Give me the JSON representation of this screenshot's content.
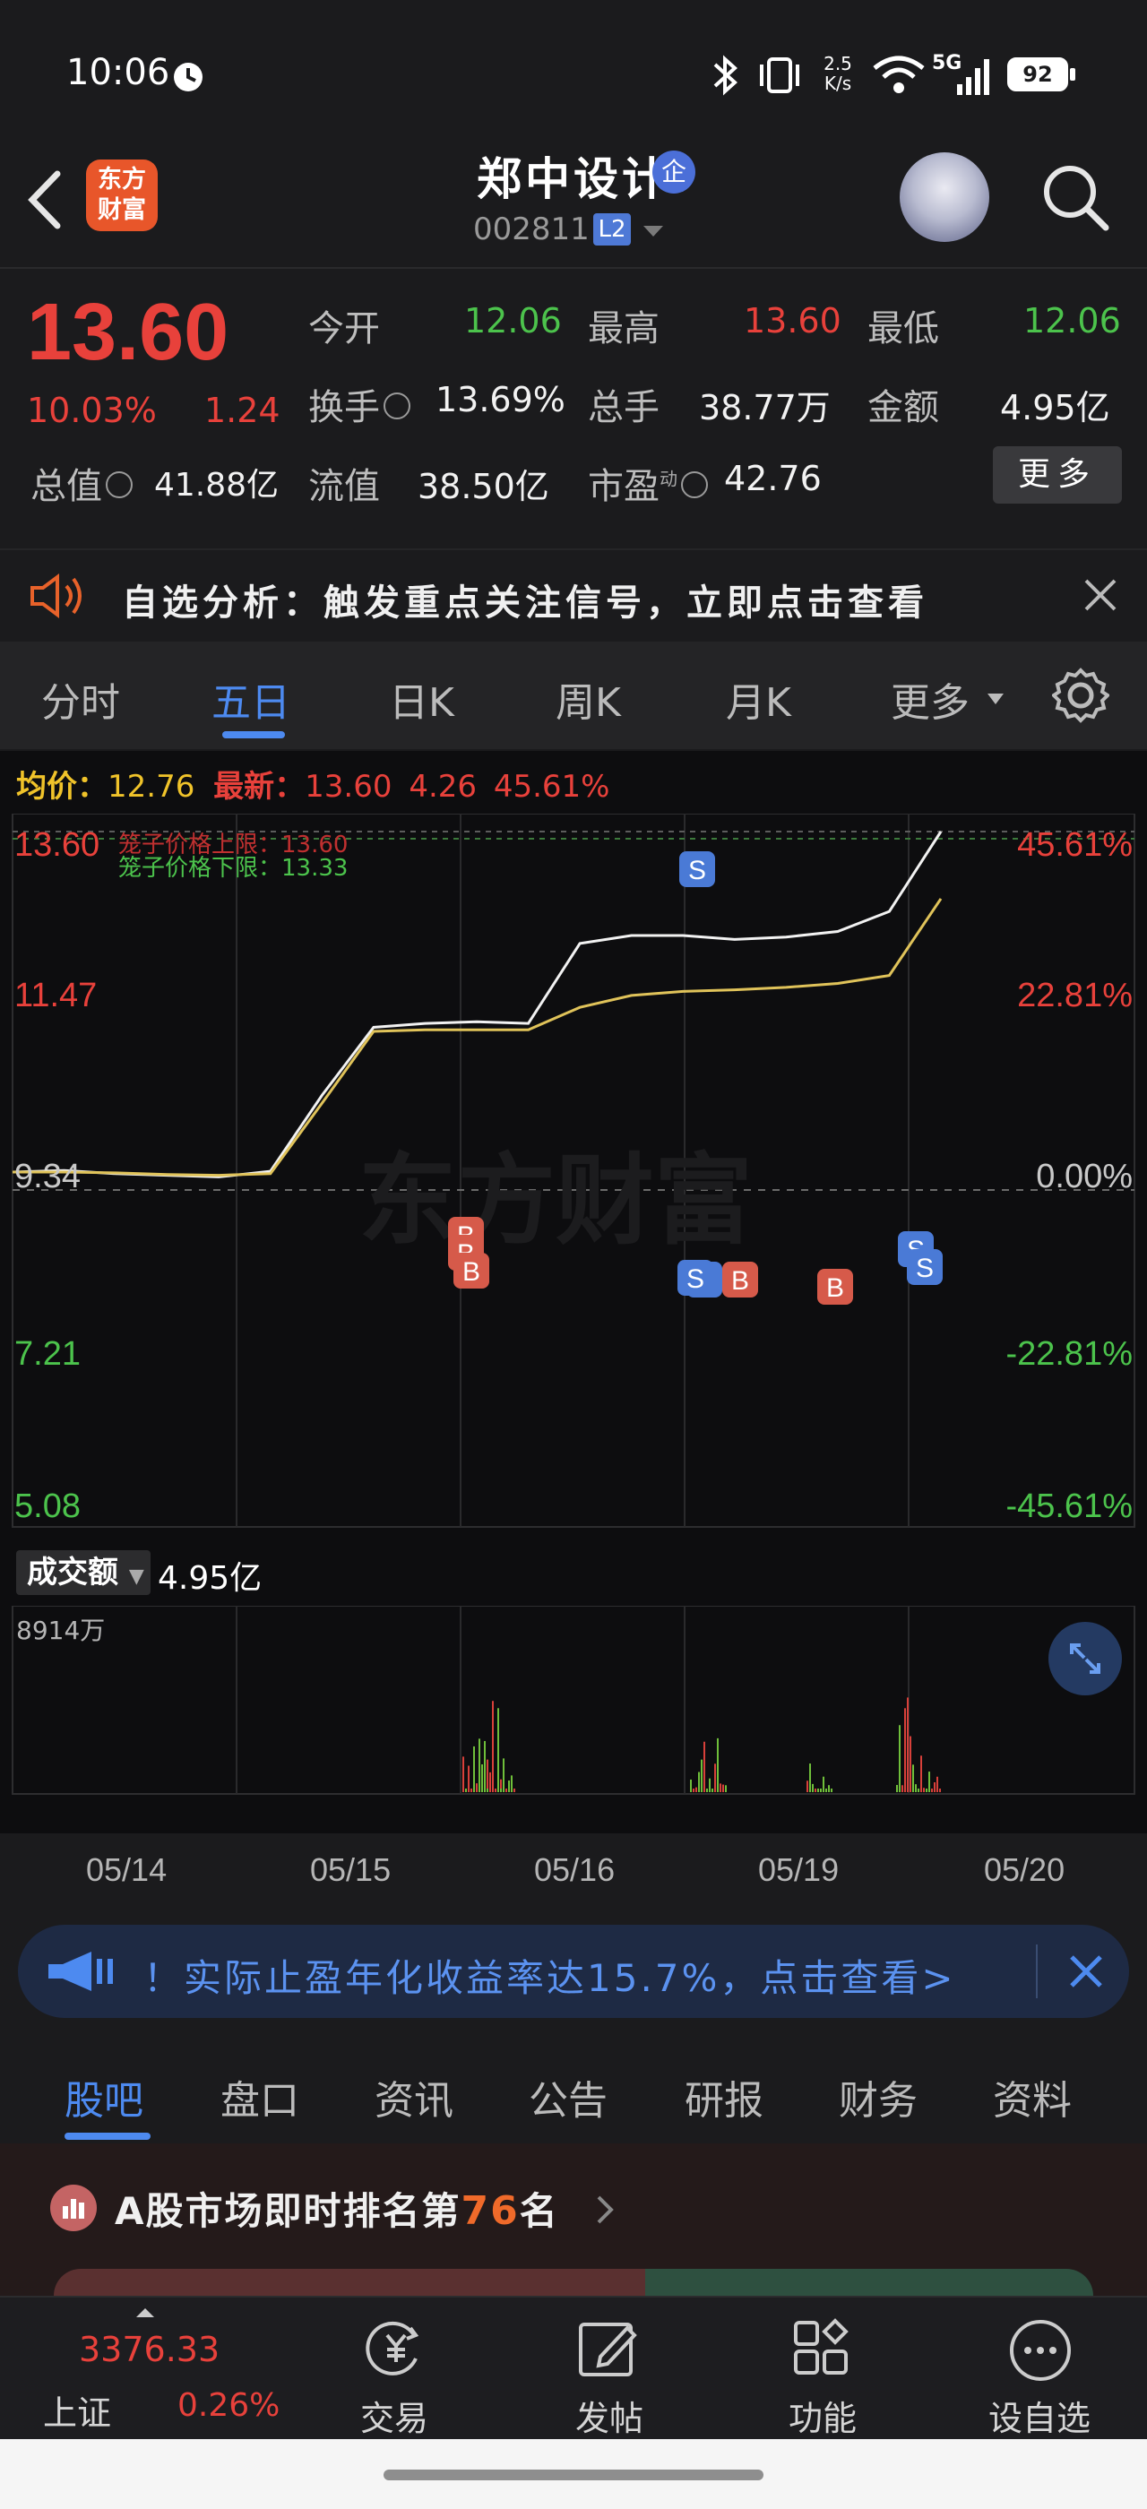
{
  "status_bar": {
    "time": "10:06",
    "net_speed": "2.5\nK/s",
    "network": "5G",
    "battery": "92"
  },
  "header": {
    "logo_text": "东方\n财富",
    "stock_name": "郑中设计",
    "company_badge": "企",
    "stock_code": "002811",
    "level_badge": "L2"
  },
  "quote": {
    "price": "13.60",
    "change_pct": "10.03%",
    "change": "1.24",
    "rows": [
      [
        {
          "label": "今开",
          "value": "12.06",
          "color": "green"
        },
        {
          "label": "最高",
          "value": "13.60",
          "color": "red"
        },
        {
          "label": "最低",
          "value": "12.06",
          "color": "green"
        }
      ],
      [
        {
          "label": "换手",
          "value": "13.69%",
          "color": "white"
        },
        {
          "label": "总手",
          "value": "38.77万",
          "color": "white"
        },
        {
          "label": "金额",
          "value": "4.95亿",
          "color": "white"
        }
      ],
      [
        {
          "label": "总值",
          "value": "41.88亿",
          "color": "white"
        },
        {
          "label": "流值",
          "value": "38.50亿",
          "color": "white"
        },
        {
          "label": "市盈",
          "value": "42.76",
          "color": "white"
        }
      ]
    ],
    "pe_superscript": "动",
    "more_button": "更多"
  },
  "notice": {
    "text": "自选分析：触发重点关注信号，立即点击查看"
  },
  "chart_tabs": [
    "分时",
    "五日",
    "日K",
    "周K",
    "月K",
    "更多"
  ],
  "chart": {
    "avg_label": "均价：",
    "avg_value": "12.76",
    "latest_label": "最新：",
    "latest_value": "13.60",
    "latest_change": "4.26",
    "latest_pct": "45.61%",
    "upper_limit_label": "笼子价格上限：13.60",
    "lower_limit_label": "笼子价格下限：13.33",
    "watermark": "东方财富",
    "volume_selector": "成交额",
    "volume_value": "4.95亿",
    "volume_max": "8914万"
  },
  "chart_data": {
    "type": "line",
    "x": [
      "05/14",
      "05/15",
      "05/16",
      "05/19",
      "05/20"
    ],
    "y_ticks_left": [
      "13.60",
      "11.47",
      "9.34",
      "7.21",
      "5.08"
    ],
    "y_ticks_right": [
      "45.61%",
      "22.81%",
      "0.00%",
      "-22.81%",
      "-45.61%"
    ],
    "ylim": [
      5.08,
      13.6
    ],
    "series": [
      {
        "name": "最新",
        "values": [
          9.34,
          9.36,
          9.32,
          9.3,
          9.28,
          9.35,
          10.3,
          11.15,
          11.2,
          11.22,
          11.2,
          12.2,
          12.3,
          12.3,
          12.25,
          12.28,
          12.35,
          12.6,
          13.6
        ]
      },
      {
        "name": "均价",
        "values": [
          9.34,
          9.34,
          9.33,
          9.31,
          9.3,
          9.32,
          10.2,
          11.1,
          11.12,
          11.12,
          11.12,
          11.4,
          11.55,
          11.6,
          11.62,
          11.65,
          11.7,
          11.8,
          12.76
        ]
      }
    ],
    "signals": [
      "B",
      "B",
      "B",
      "S",
      "S",
      "B",
      "B",
      "S",
      "S",
      "S"
    ]
  },
  "ad": {
    "text": "！实际止盈年化收益率达15.7%，点击查看>"
  },
  "info_tabs": [
    "股吧",
    "盘口",
    "资讯",
    "公告",
    "研报",
    "财务",
    "资料"
  ],
  "rank": {
    "prefix": "A股市场即时排名第",
    "rank": "76",
    "suffix": "名"
  },
  "bottom_nav": {
    "index_value": "3376.33",
    "index_name": "上证",
    "index_pct": "0.26%",
    "items": [
      "交易",
      "发帖",
      "功能",
      "设自选"
    ]
  }
}
